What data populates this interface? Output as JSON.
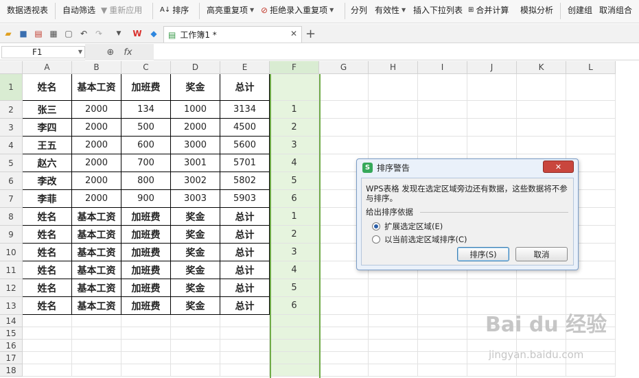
{
  "ribbon": {
    "pivot": "数据透视表",
    "autofilter": "自动筛选",
    "reapply": "重新应用",
    "sort": "排序",
    "highlight_dup": "高亮重复项",
    "reject_dup": "拒绝录入重复项",
    "split": "分列",
    "validity": "有效性",
    "insert_dropdown": "插入下拉列表",
    "merge_calc": "合并计算",
    "simulate": "模拟分析",
    "create_group": "创建组",
    "ungroup": "取消组合"
  },
  "tab": {
    "title": "工作簿1 *"
  },
  "formula_bar": {
    "name_box": "F1",
    "fx": "fx"
  },
  "sheet": {
    "columns": [
      "A",
      "B",
      "C",
      "D",
      "E",
      "F",
      "G",
      "H",
      "I",
      "J",
      "K",
      "L"
    ],
    "rows": [
      "1",
      "2",
      "3",
      "4",
      "5",
      "6",
      "7",
      "8",
      "9",
      "10",
      "11",
      "12",
      "13",
      "14",
      "15",
      "16",
      "17",
      "18"
    ],
    "data": [
      [
        "姓名",
        "基本工资",
        "加班费",
        "奖金",
        "总计",
        ""
      ],
      [
        "张三",
        "2000",
        "134",
        "1000",
        "3134",
        "1"
      ],
      [
        "李四",
        "2000",
        "500",
        "2000",
        "4500",
        "2"
      ],
      [
        "王五",
        "2000",
        "600",
        "3000",
        "5600",
        "3"
      ],
      [
        "赵六",
        "2000",
        "700",
        "3001",
        "5701",
        "4"
      ],
      [
        "李改",
        "2000",
        "800",
        "3002",
        "5802",
        "5"
      ],
      [
        "李菲",
        "2000",
        "900",
        "3003",
        "5903",
        "6"
      ],
      [
        "姓名",
        "基本工资",
        "加班费",
        "奖金",
        "总计",
        "1"
      ],
      [
        "姓名",
        "基本工资",
        "加班费",
        "奖金",
        "总计",
        "2"
      ],
      [
        "姓名",
        "基本工资",
        "加班费",
        "奖金",
        "总计",
        "3"
      ],
      [
        "姓名",
        "基本工资",
        "加班费",
        "奖金",
        "总计",
        "4"
      ],
      [
        "姓名",
        "基本工资",
        "加班费",
        "奖金",
        "总计",
        "5"
      ],
      [
        "姓名",
        "基本工资",
        "加班费",
        "奖金",
        "总计",
        "6"
      ]
    ]
  },
  "dialog": {
    "title": "排序警告",
    "message": "WPS表格 发现在选定区域旁边还有数据，这些数据将不参与排序。",
    "group_label": "给出排序依据",
    "option_expand": "扩展选定区域(E)",
    "option_current": "以当前选定区域排序(C)",
    "sort_button": "排序(S)",
    "cancel_button": "取消"
  },
  "watermark": {
    "text": "Bai du 经验",
    "url": "jingyan.baidu.com"
  },
  "colors": {
    "accent_green": "#6faa47",
    "selection_fill": "#e6f4de"
  }
}
